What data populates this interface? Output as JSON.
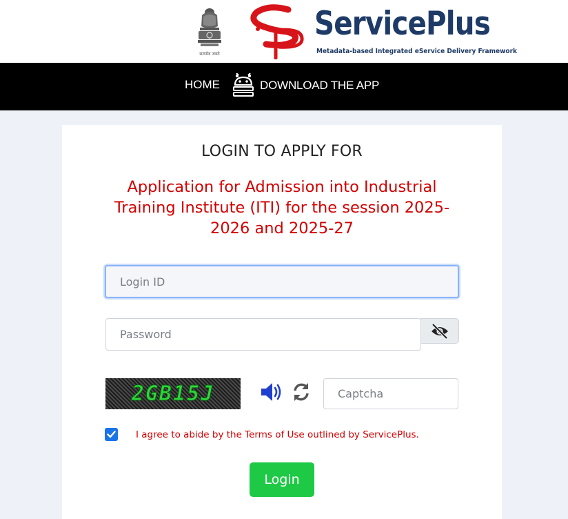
{
  "header": {
    "emblem_caption": "सत्यमेव जयते",
    "brand_name": "ServicePlus",
    "brand_tagline": "Metadata-based Integrated eService Delivery Framework",
    "colors": {
      "brand_blue": "#1e3a66",
      "brand_red": "#d7141a"
    }
  },
  "nav": {
    "home": "HOME",
    "download": "DOWNLOAD THE APP",
    "download_icon": "android-icon"
  },
  "login": {
    "heading": "LOGIN TO APPLY FOR",
    "application_title": "Application for Admission into Industrial Training Institute (ITI) for the session 2025-2026 and 2025-27",
    "login_id_placeholder": "Login ID",
    "login_id_value": "",
    "password_placeholder": "Password",
    "password_value": "",
    "captcha_code": "2GB15J",
    "captcha_placeholder": "Captcha",
    "captcha_value": "",
    "terms_checked": true,
    "terms_text": "I agree to abide by the Terms of Use outlined by ServicePlus.",
    "login_button": "Login",
    "colors": {
      "title_red": "#d20000",
      "button_green": "#1ec946",
      "check_blue": "#1a73e8"
    }
  }
}
